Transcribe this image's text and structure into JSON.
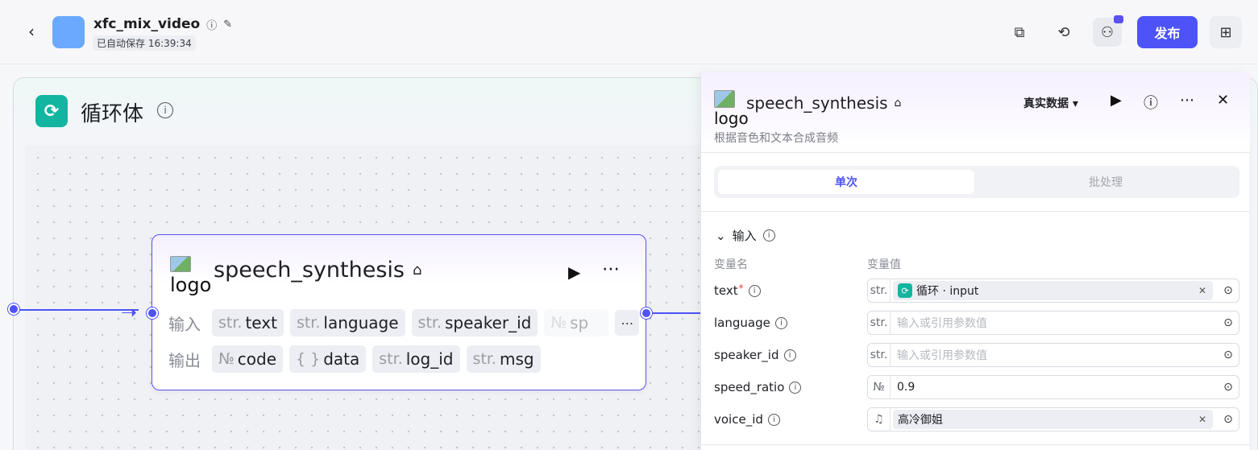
{
  "header": {
    "title": "xfc_mix_video",
    "saved_status": "已自动保存 16:39:34",
    "publish_label": "发布",
    "brand_color": "#4d53f6",
    "icons": [
      "back-icon",
      "info-icon",
      "edit-icon",
      "copy-icon",
      "history-icon",
      "users-icon",
      "add-page-icon"
    ]
  },
  "loop": {
    "title": "循环体"
  },
  "node": {
    "logo_alt": "logo",
    "title": "speech_synthesis",
    "inputs_label": "输入",
    "outputs_label": "输出",
    "inputs": [
      {
        "type": "str.",
        "name": "text"
      },
      {
        "type": "str.",
        "name": "language"
      },
      {
        "type": "str.",
        "name": "speaker_id"
      },
      {
        "type": "№",
        "name": "sp"
      }
    ],
    "outputs": [
      {
        "type": "№",
        "name": "code"
      },
      {
        "type": "{ }",
        "name": "data"
      },
      {
        "type": "str.",
        "name": "log_id"
      },
      {
        "type": "str.",
        "name": "msg"
      }
    ],
    "more_label": "⋯"
  },
  "panel": {
    "logo_alt": "logo",
    "title": "speech_synthesis",
    "description": "根据音色和文本合成音频",
    "mode": "真实数据",
    "tabs": {
      "single": "单次",
      "batch": "批处理"
    },
    "section_title": "输入",
    "col_name": "变量名",
    "col_value": "变量值",
    "fields": [
      {
        "name": "text",
        "required": "*",
        "type": "str.",
        "value": "循环 · input",
        "kind": "ref"
      },
      {
        "name": "language",
        "type": "str.",
        "value": "输入或引用参数值",
        "kind": "placeholder"
      },
      {
        "name": "speaker_id",
        "type": "str.",
        "value": "输入或引用参数值",
        "kind": "placeholder"
      },
      {
        "name": "speed_ratio",
        "type": "№",
        "value": "0.9",
        "kind": "value"
      },
      {
        "name": "voice_id",
        "type": "♫",
        "value": "高冷御姐",
        "kind": "chip"
      }
    ]
  }
}
